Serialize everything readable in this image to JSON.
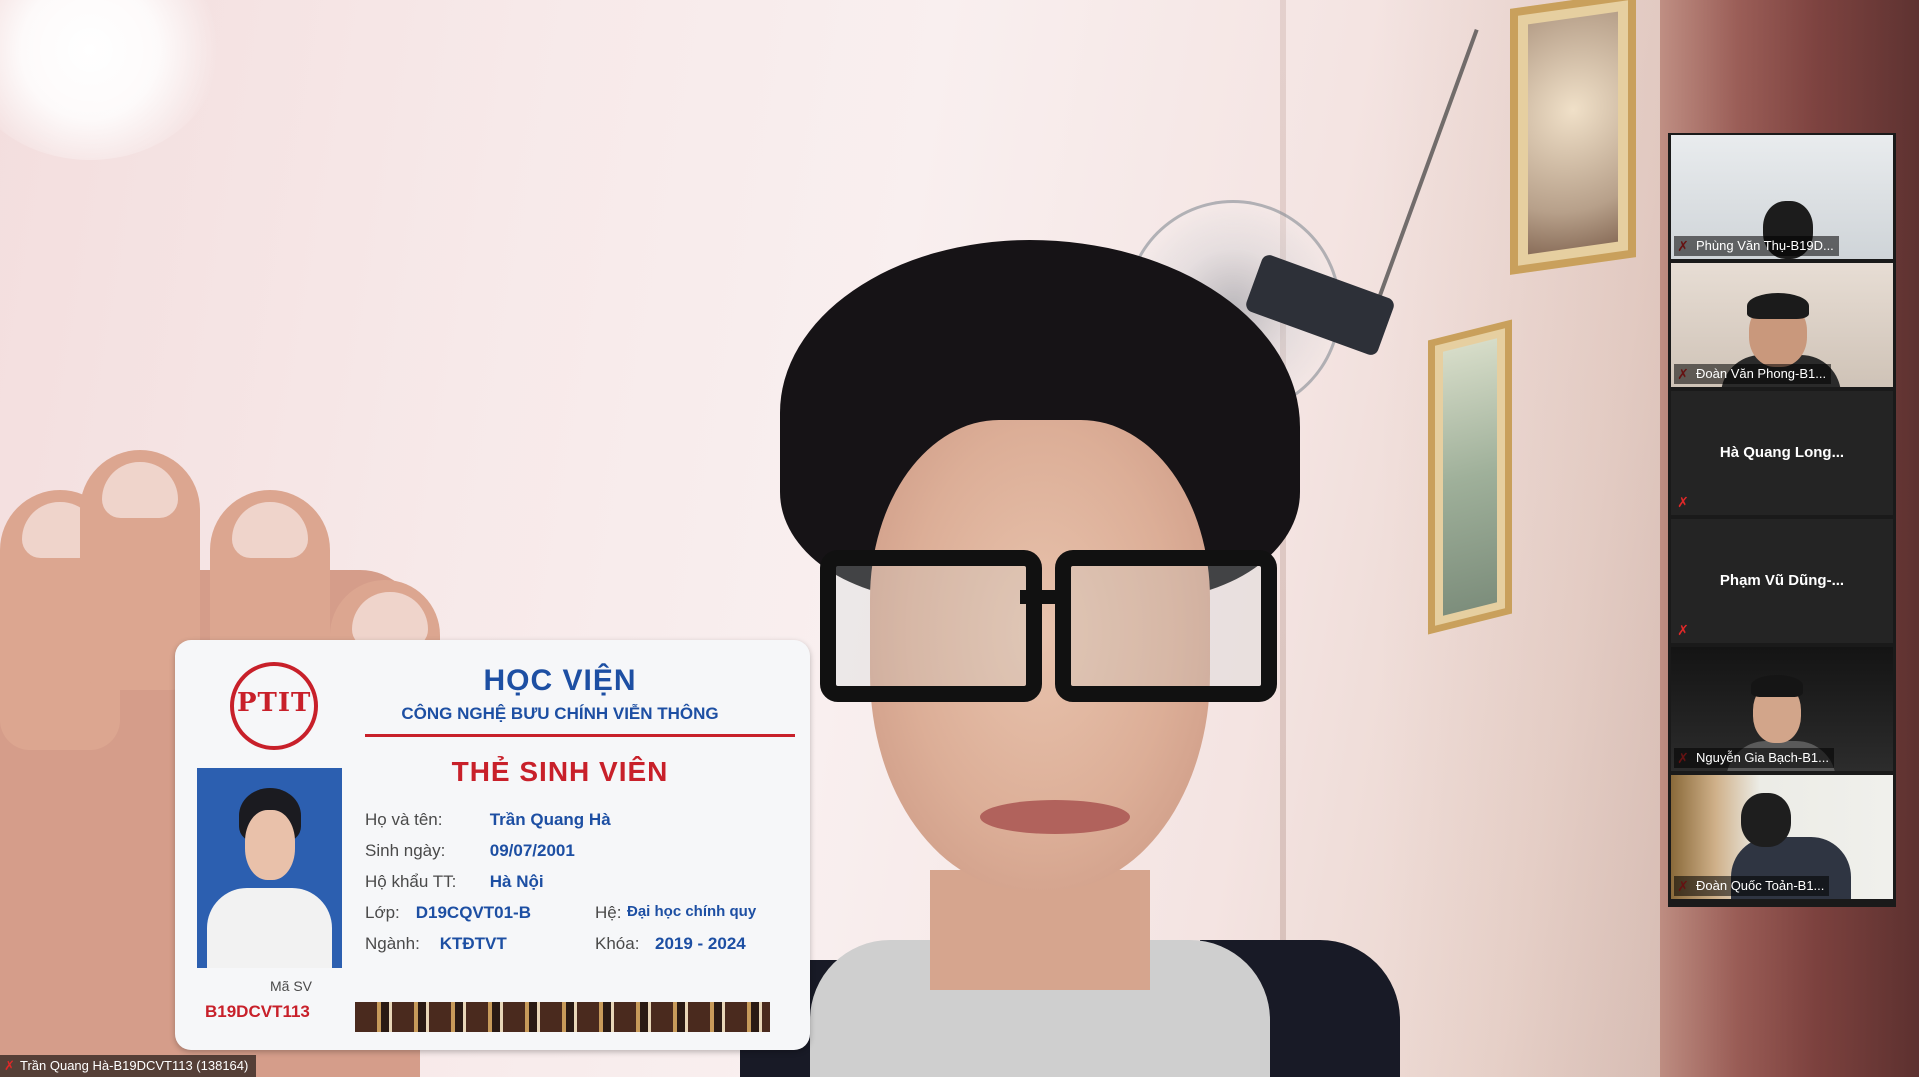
{
  "main_video": {
    "participant_label": "Trần Quang Hà-B19DCVT113 (138164)",
    "muted": true
  },
  "id_card": {
    "logo_text": "PTIT",
    "institute_line1": "HỌC VIỆN",
    "institute_line2": "CÔNG NGHỆ BƯU CHÍNH VIỄN THÔNG",
    "card_title": "THẺ SINH VIÊN",
    "fields": [
      {
        "label": "Họ và tên:",
        "value": "Trần Quang Hà"
      },
      {
        "label": "Sinh ngày:",
        "value": "09/07/2001"
      },
      {
        "label": "Hộ khẩu TT:",
        "value": "Hà Nội"
      }
    ],
    "class_label": "Lớp:",
    "class_value": "D19CQVT01-B",
    "system_label": "Hệ:",
    "system_value": "Đại học chính quy",
    "major_label": "Ngành:",
    "major_value": "KTĐTVT",
    "course_label": "Khóa:",
    "course_value": "2019 - 2024",
    "student_id_label": "Mã SV",
    "student_id": "B19DCVT113"
  },
  "participants": [
    {
      "name": "Phùng Văn Thụ-B19D...",
      "video": true,
      "muted": true
    },
    {
      "name": "Đoàn Văn Phong-B1...",
      "video": true,
      "muted": true
    },
    {
      "name": "Hà Quang Long...",
      "video": false,
      "muted": true
    },
    {
      "name": "Phạm Vũ Dũng-...",
      "video": false,
      "muted": true
    },
    {
      "name": "Nguyễn Gia Bạch-B1...",
      "video": true,
      "muted": true
    },
    {
      "name": "Đoàn Quốc Toản-B1...",
      "video": true,
      "muted": true
    }
  ],
  "colors": {
    "mute_icon": "#e02828",
    "card_blue": "#1d4fa3",
    "card_red": "#c8202a"
  },
  "icons": {
    "mute": "muted-microphone-icon"
  }
}
